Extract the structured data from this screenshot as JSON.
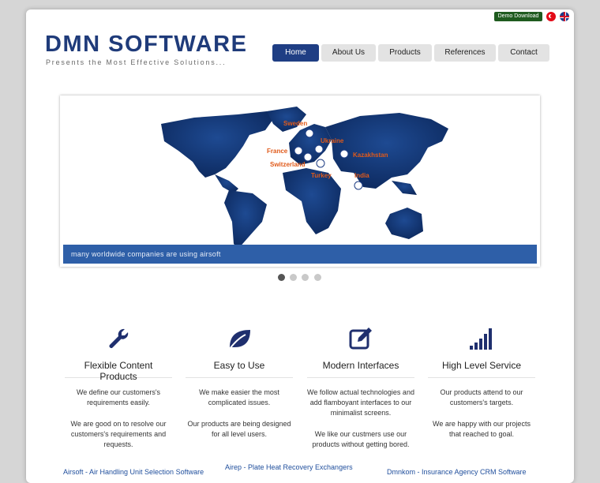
{
  "header": {
    "demo_download": "Demo Download",
    "flags": [
      "turkish-flag-icon",
      "english-flag-icon"
    ],
    "logo_title": "DMN SOFTWARE",
    "logo_tagline": "Presents the Most Effective Solutions..."
  },
  "nav": {
    "items": [
      {
        "label": "Home",
        "active": true
      },
      {
        "label": "About Us",
        "active": false
      },
      {
        "label": "Products",
        "active": false
      },
      {
        "label": "References",
        "active": false
      },
      {
        "label": "Contact",
        "active": false
      }
    ]
  },
  "slider": {
    "countries": [
      "Sweden",
      "Ukraine",
      "France",
      "Kazakhstan",
      "Switzerland",
      "Turkey",
      "India"
    ],
    "caption": "many worldwide companies are using airsoft",
    "dot_count": 4,
    "active_dot": 1
  },
  "features": [
    {
      "title": "Flexible Content Products",
      "icon": "wrench-icon",
      "p1": "We define our customers's requirements easily.",
      "p2": "We are good on to resolve our customers's requirements and requests."
    },
    {
      "title": "Easy to Use",
      "icon": "leaf-icon",
      "p1": "We make easier the most complicated issues.",
      "p2": "Our products are being designed for all level users."
    },
    {
      "title": "Modern Interfaces",
      "icon": "edit-icon",
      "p1": "We follow actual technologies and add flamboyant interfaces to our minimalist screens.",
      "p2": "We like our custmers use our products without getting bored."
    },
    {
      "title": "High Level Service",
      "icon": "signal-bars-icon",
      "p1": "Our products attend to our customers's targets.",
      "p2": "We are happy with our projects that reached to goal."
    }
  ],
  "products": {
    "links": [
      "Airsoft - Air Handling Unit Selection Software",
      "Airep - Plate Heat Recovery Exchangers",
      "Dmnkom - Insurance Agency CRM Software"
    ]
  },
  "colors": {
    "brand": "#1f3b7a",
    "nav_active": "#1f3e84",
    "caption_bar": "#2e5fa8",
    "country_label": "#e05a1a",
    "map_ocean": "#0e2e66"
  }
}
